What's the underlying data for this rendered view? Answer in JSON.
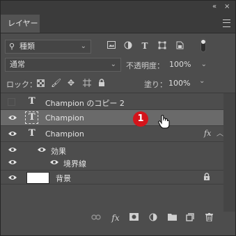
{
  "panel": {
    "tab_label": "レイヤー",
    "top_icons": {
      "collapse": "«",
      "close": "×"
    }
  },
  "filter": {
    "kind_label": "種類",
    "icons": [
      "image-filter-icon",
      "adjustment-filter-icon",
      "type-filter-icon",
      "shape-filter-icon",
      "smart-object-filter-icon",
      "filter-toggle-icon"
    ]
  },
  "blend": {
    "mode": "通常",
    "opacity_label": "不透明度：",
    "opacity_value": "100%"
  },
  "lock": {
    "label": "ロック：",
    "fill_label": "塗り：",
    "fill_value": "100%"
  },
  "layers": [
    {
      "name": "Champion のコピー 2",
      "type": "text",
      "visible": false,
      "selected": false
    },
    {
      "name": "Champion",
      "type": "text",
      "visible": true,
      "selected": true
    },
    {
      "name": "Champion",
      "type": "text",
      "visible": true,
      "selected": false,
      "fx": "fx"
    },
    {
      "name": "効果",
      "type": "effects",
      "visible": true
    },
    {
      "name": "境界線",
      "type": "effect",
      "visible": true
    },
    {
      "name": "背景",
      "type": "background",
      "visible": true,
      "locked": true
    }
  ],
  "annotation": {
    "step": "1",
    "color": "#d3141b"
  },
  "bottom_icons": [
    "link-layers-icon",
    "fx-icon",
    "mask-icon",
    "adjustment-layer-icon",
    "group-folder-icon",
    "new-layer-icon",
    "trash-icon"
  ],
  "bottom_fx_label": "fx"
}
